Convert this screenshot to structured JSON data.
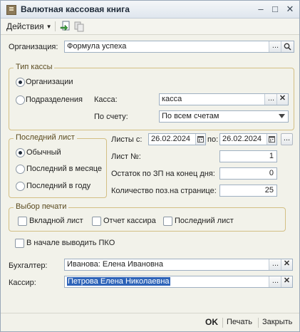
{
  "window": {
    "title": "Валютная кассовая книга",
    "minimize": "–",
    "maximize": "□",
    "close": "✕"
  },
  "toolbar": {
    "actions_label": "Действия"
  },
  "org": {
    "label": "Организация:",
    "value": "Формула успеха",
    "more": "...",
    "search": "⚲"
  },
  "cash_type": {
    "title": "Тип кассы",
    "option_org": "Организации",
    "option_sub": "Подразделения",
    "kassa_label": "Касса:",
    "kassa_value": "касса",
    "account_label": "По счету:",
    "account_value": "По всем счетам",
    "selected": "Организации"
  },
  "last_sheet": {
    "title": "Последний лист",
    "opt1": "Обычный",
    "opt2": "Последний в месяце",
    "opt3": "Последний в году",
    "selected": "Обычный"
  },
  "sheets": {
    "from_label": "Листы с:",
    "from_value": "26.02.2024",
    "to_label": "по:",
    "to_value": "26.02.2024",
    "sheet_no_label": "Лист №:",
    "sheet_no_value": "1",
    "balance_label": "Остаток по ЗП на конец дня:",
    "balance_value": "0",
    "count_label": "Количество поз.на странице:",
    "count_value": "25"
  },
  "print_choice": {
    "title": "Выбор печати",
    "opt1": "Вкладной лист",
    "opt2": "Отчет кассира",
    "opt3": "Последний лист"
  },
  "pko": {
    "label": "В начале выводить ПКО"
  },
  "accountant": {
    "label": "Бухгалтер:",
    "value": "Иванова: Елена Ивановна"
  },
  "cashier": {
    "label": "Кассир:",
    "value": "Петрова Елена Николаевна"
  },
  "footer": {
    "ok": "OK",
    "print": "Печать",
    "close": "Закрыть"
  },
  "colors": {
    "group_border": "#d3bf84",
    "window_bg": "#f2f2ea",
    "selection": "#2d63b8"
  }
}
